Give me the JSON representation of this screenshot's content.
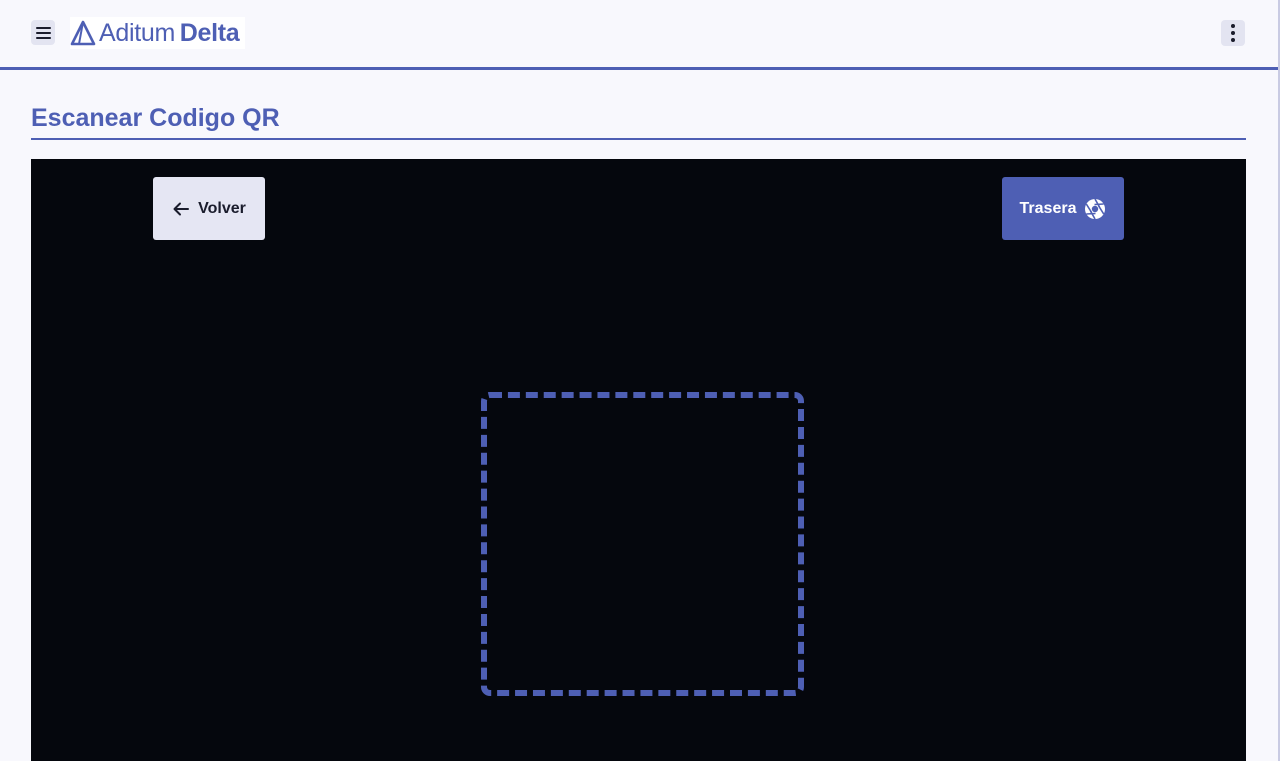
{
  "header": {
    "logo": {
      "light": "Aditum",
      "bold": "Delta"
    },
    "menu_icon": "hamburger-menu-icon",
    "more_icon": "more-vertical-icon"
  },
  "page": {
    "title": "Escanear Codigo QR"
  },
  "scanner": {
    "back_label": "Volver",
    "back_icon": "arrow-left-icon",
    "camera_label": "Trasera",
    "camera_icon": "camera-aperture-icon"
  },
  "colors": {
    "accent": "#4e5fb4",
    "camera_background": "#05070d",
    "page_background": "#f8f8fd",
    "secondary_button": "#e5e6f3"
  }
}
